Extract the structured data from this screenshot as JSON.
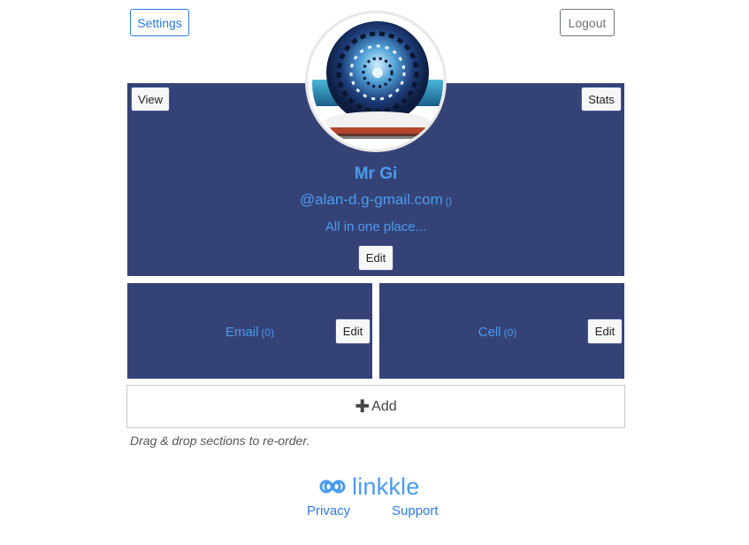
{
  "header": {
    "settings_label": "Settings",
    "logout_label": "Logout"
  },
  "profile": {
    "view_label": "View",
    "stats_label": "Stats",
    "name": "Mr Gi",
    "handle": "@alan-d.g-gmail.com",
    "handle_count": "()",
    "tagline": "All in one place...",
    "edit_label": "Edit"
  },
  "sections": [
    {
      "title": "Email",
      "count": "(0)",
      "edit_label": "Edit"
    },
    {
      "title": "Cell",
      "count": "(0)",
      "edit_label": "Edit"
    }
  ],
  "add": {
    "icon": "plus-icon",
    "label": "Add"
  },
  "hint": "Drag & drop sections to re-order.",
  "footer": {
    "brand": "linkkle",
    "logo_icon": "infinity-icon",
    "privacy_label": "Privacy",
    "support_label": "Support"
  },
  "colors": {
    "panel": "#354275",
    "accent": "#4b9bf0",
    "link": "#2c7be5"
  }
}
